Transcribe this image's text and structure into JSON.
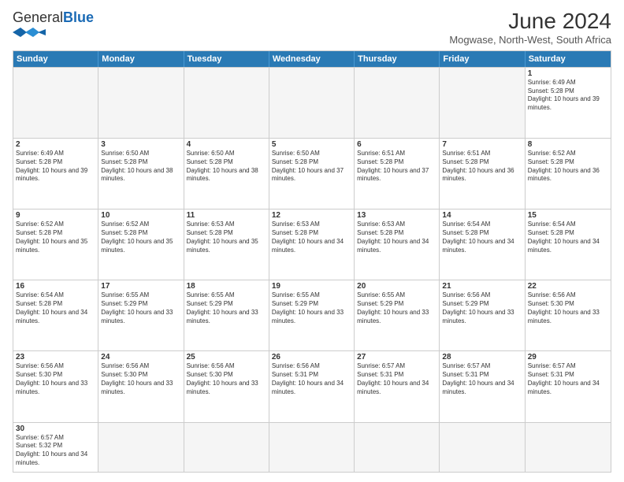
{
  "header": {
    "logo_general": "General",
    "logo_blue": "Blue",
    "title": "June 2024",
    "location": "Mogwase, North-West, South Africa"
  },
  "days_of_week": [
    "Sunday",
    "Monday",
    "Tuesday",
    "Wednesday",
    "Thursday",
    "Friday",
    "Saturday"
  ],
  "weeks": [
    [
      {
        "day": "",
        "empty": true
      },
      {
        "day": "",
        "empty": true
      },
      {
        "day": "",
        "empty": true
      },
      {
        "day": "",
        "empty": true
      },
      {
        "day": "",
        "empty": true
      },
      {
        "day": "",
        "empty": true
      },
      {
        "day": "1",
        "sunrise": "6:49 AM",
        "sunset": "5:28 PM",
        "daylight": "10 hours and 39 minutes."
      }
    ],
    [
      {
        "day": "2",
        "sunrise": "6:49 AM",
        "sunset": "5:28 PM",
        "daylight": "10 hours and 39 minutes."
      },
      {
        "day": "3",
        "sunrise": "6:50 AM",
        "sunset": "5:28 PM",
        "daylight": "10 hours and 38 minutes."
      },
      {
        "day": "4",
        "sunrise": "6:50 AM",
        "sunset": "5:28 PM",
        "daylight": "10 hours and 38 minutes."
      },
      {
        "day": "5",
        "sunrise": "6:50 AM",
        "sunset": "5:28 PM",
        "daylight": "10 hours and 37 minutes."
      },
      {
        "day": "6",
        "sunrise": "6:51 AM",
        "sunset": "5:28 PM",
        "daylight": "10 hours and 37 minutes."
      },
      {
        "day": "7",
        "sunrise": "6:51 AM",
        "sunset": "5:28 PM",
        "daylight": "10 hours and 36 minutes."
      },
      {
        "day": "8",
        "sunrise": "6:52 AM",
        "sunset": "5:28 PM",
        "daylight": "10 hours and 36 minutes."
      }
    ],
    [
      {
        "day": "9",
        "sunrise": "6:52 AM",
        "sunset": "5:28 PM",
        "daylight": "10 hours and 35 minutes."
      },
      {
        "day": "10",
        "sunrise": "6:52 AM",
        "sunset": "5:28 PM",
        "daylight": "10 hours and 35 minutes."
      },
      {
        "day": "11",
        "sunrise": "6:53 AM",
        "sunset": "5:28 PM",
        "daylight": "10 hours and 35 minutes."
      },
      {
        "day": "12",
        "sunrise": "6:53 AM",
        "sunset": "5:28 PM",
        "daylight": "10 hours and 34 minutes."
      },
      {
        "day": "13",
        "sunrise": "6:53 AM",
        "sunset": "5:28 PM",
        "daylight": "10 hours and 34 minutes."
      },
      {
        "day": "14",
        "sunrise": "6:54 AM",
        "sunset": "5:28 PM",
        "daylight": "10 hours and 34 minutes."
      },
      {
        "day": "15",
        "sunrise": "6:54 AM",
        "sunset": "5:28 PM",
        "daylight": "10 hours and 34 minutes."
      }
    ],
    [
      {
        "day": "16",
        "sunrise": "6:54 AM",
        "sunset": "5:28 PM",
        "daylight": "10 hours and 34 minutes."
      },
      {
        "day": "17",
        "sunrise": "6:55 AM",
        "sunset": "5:29 PM",
        "daylight": "10 hours and 33 minutes."
      },
      {
        "day": "18",
        "sunrise": "6:55 AM",
        "sunset": "5:29 PM",
        "daylight": "10 hours and 33 minutes."
      },
      {
        "day": "19",
        "sunrise": "6:55 AM",
        "sunset": "5:29 PM",
        "daylight": "10 hours and 33 minutes."
      },
      {
        "day": "20",
        "sunrise": "6:55 AM",
        "sunset": "5:29 PM",
        "daylight": "10 hours and 33 minutes."
      },
      {
        "day": "21",
        "sunrise": "6:56 AM",
        "sunset": "5:29 PM",
        "daylight": "10 hours and 33 minutes."
      },
      {
        "day": "22",
        "sunrise": "6:56 AM",
        "sunset": "5:30 PM",
        "daylight": "10 hours and 33 minutes."
      }
    ],
    [
      {
        "day": "23",
        "sunrise": "6:56 AM",
        "sunset": "5:30 PM",
        "daylight": "10 hours and 33 minutes."
      },
      {
        "day": "24",
        "sunrise": "6:56 AM",
        "sunset": "5:30 PM",
        "daylight": "10 hours and 33 minutes."
      },
      {
        "day": "25",
        "sunrise": "6:56 AM",
        "sunset": "5:30 PM",
        "daylight": "10 hours and 33 minutes."
      },
      {
        "day": "26",
        "sunrise": "6:56 AM",
        "sunset": "5:31 PM",
        "daylight": "10 hours and 34 minutes."
      },
      {
        "day": "27",
        "sunrise": "6:57 AM",
        "sunset": "5:31 PM",
        "daylight": "10 hours and 34 minutes."
      },
      {
        "day": "28",
        "sunrise": "6:57 AM",
        "sunset": "5:31 PM",
        "daylight": "10 hours and 34 minutes."
      },
      {
        "day": "29",
        "sunrise": "6:57 AM",
        "sunset": "5:31 PM",
        "daylight": "10 hours and 34 minutes."
      }
    ],
    [
      {
        "day": "30",
        "sunrise": "6:57 AM",
        "sunset": "5:32 PM",
        "daylight": "10 hours and 34 minutes."
      },
      {
        "day": "",
        "empty": true
      },
      {
        "day": "",
        "empty": true
      },
      {
        "day": "",
        "empty": true
      },
      {
        "day": "",
        "empty": true
      },
      {
        "day": "",
        "empty": true
      },
      {
        "day": "",
        "empty": true
      }
    ]
  ]
}
